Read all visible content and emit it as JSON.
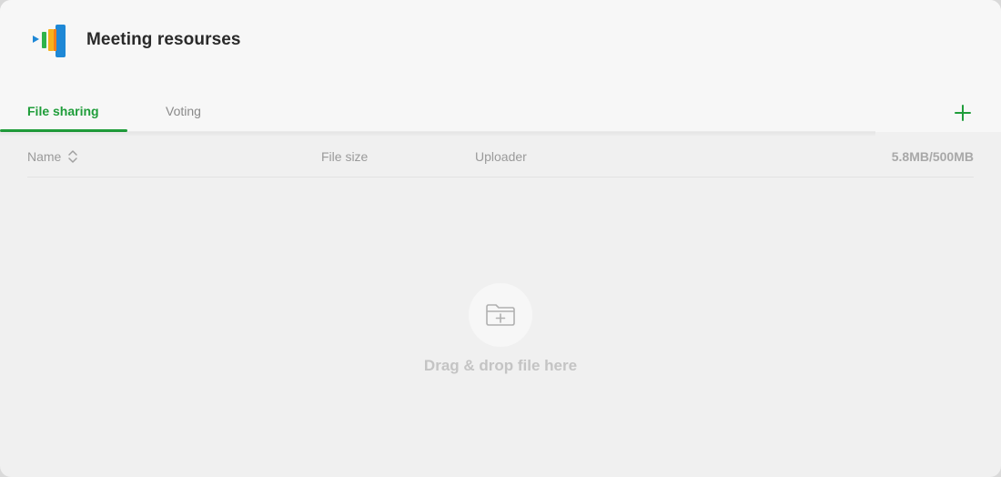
{
  "header": {
    "title": "Meeting resourses",
    "logo_icon": "app-logo-icon"
  },
  "tabs": [
    {
      "label": "File sharing",
      "active": true
    },
    {
      "label": "Voting",
      "active": false
    }
  ],
  "toolbar": {
    "add_icon": "plus-icon"
  },
  "table": {
    "columns": {
      "name": "Name",
      "file_size": "File size",
      "uploader": "Uploader",
      "storage_usage": "5.8MB/500MB"
    },
    "sort_icon": "sort-updown-icon"
  },
  "dropzone": {
    "icon": "folder-plus-icon",
    "label": "Drag & drop file here"
  },
  "colors": {
    "accent": "#1f9d3a",
    "title_text": "#2a2a2a",
    "muted_text": "#9a9a9a",
    "background": "#f0f0f0"
  }
}
